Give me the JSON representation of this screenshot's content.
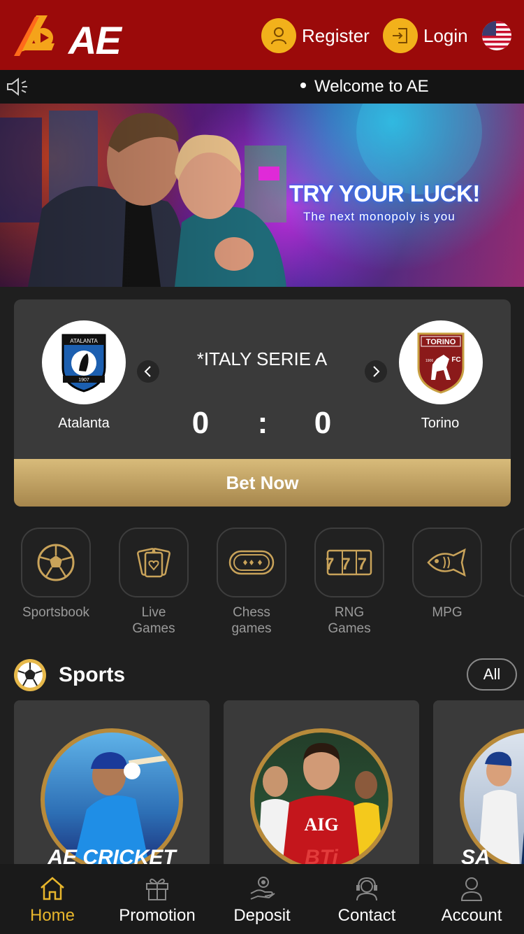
{
  "header": {
    "logo_text": "AE",
    "register_label": "Register",
    "login_label": "Login"
  },
  "marquee": {
    "text": "Welcome to AE"
  },
  "banner": {
    "title": "TRY YOUR LUCK!",
    "subtitle": "The next monopoly is you"
  },
  "match": {
    "league": "*ITALY SERIE A",
    "home_team": "Atalanta",
    "away_team": "Torino",
    "home_score": "0",
    "separator": ":",
    "away_score": "0",
    "bet_label": "Bet Now",
    "home_logo_text": "ATALANTA",
    "home_logo_year": "1907",
    "away_logo_text": "TORINO",
    "away_logo_year": "1906",
    "away_logo_fc": "FC"
  },
  "categories": [
    {
      "label": "Sportsbook"
    },
    {
      "label": "Live\nGames"
    },
    {
      "label": "Chess\ngames"
    },
    {
      "label": "RNG\nGames"
    },
    {
      "label": "MPG"
    }
  ],
  "rng_digits": "777",
  "sports": {
    "title": "Sports",
    "all_label": "All",
    "games": [
      {
        "brand": "AE CRICKET"
      },
      {
        "brand": "BTi"
      },
      {
        "brand": "SA"
      }
    ],
    "bti_jersey": "AIG"
  },
  "bottom_nav": [
    {
      "label": "Home"
    },
    {
      "label": "Promotion"
    },
    {
      "label": "Deposit"
    },
    {
      "label": "Contact"
    },
    {
      "label": "Account"
    }
  ],
  "colors": {
    "header_bg": "#9b0a0a",
    "accent_gold": "#e8b62c",
    "card_bg": "#3a3a3a",
    "page_bg": "#1f1f1f"
  }
}
